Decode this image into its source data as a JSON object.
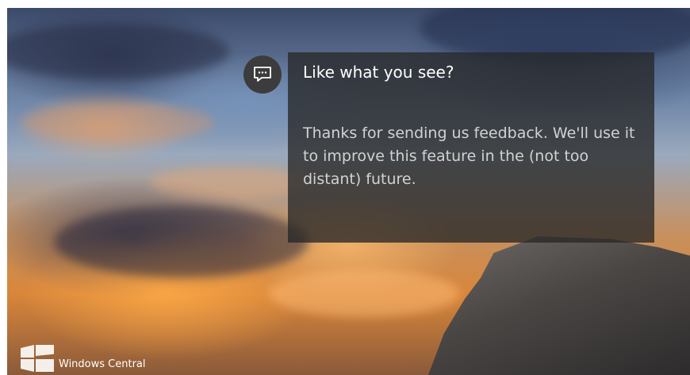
{
  "toast": {
    "icon": "feedback-message-icon",
    "title": "Like what you see?",
    "body": "Thanks for sending us feedback. We'll use it to improve this feature in the (not too distant) future."
  },
  "watermark": {
    "logo": "windows-logo-icon",
    "text": "Windows Central"
  },
  "colors": {
    "toast_background": "#282828",
    "icon_circle": "#3c3c3c",
    "title_text": "#ffffff",
    "body_text": "#d2d2d2"
  }
}
